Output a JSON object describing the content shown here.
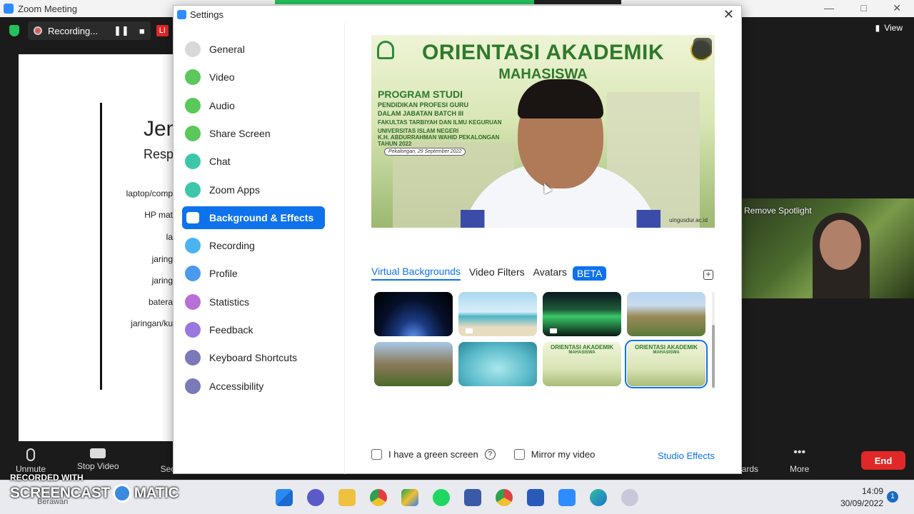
{
  "zoom_window": {
    "title": "Zoom Meeting",
    "recording_label": "Recording...",
    "live_badge": "LI",
    "view_label": "View",
    "spotlight_label": "Remove Spotlight"
  },
  "shared_slide": {
    "title": "Jen",
    "subtitle": "Resp",
    "lines": [
      "laptop/comp",
      "HP mat",
      "la",
      "jaring",
      "jaring",
      "batera",
      "jaringan/ku"
    ]
  },
  "toolbar": {
    "unmute": "Unmute",
    "stop_video": "Stop Video",
    "security": "Sec",
    "boards": "oards",
    "more": "More",
    "end": "End"
  },
  "settings": {
    "title": "Settings",
    "nav": [
      {
        "label": "General",
        "icon": "gear-icon",
        "color": "#d8d8d8"
      },
      {
        "label": "Video",
        "icon": "video-icon",
        "color": "#5ac85a"
      },
      {
        "label": "Audio",
        "icon": "headphones-icon",
        "color": "#5ac85a"
      },
      {
        "label": "Share Screen",
        "icon": "share-screen-icon",
        "color": "#5ac85a"
      },
      {
        "label": "Chat",
        "icon": "chat-icon",
        "color": "#3cc8a8"
      },
      {
        "label": "Zoom Apps",
        "icon": "apps-icon",
        "color": "#3cc8a8"
      },
      {
        "label": "Background & Effects",
        "icon": "background-icon",
        "color": "#ffffff"
      },
      {
        "label": "Recording",
        "icon": "record-icon",
        "color": "#4ab4f0"
      },
      {
        "label": "Profile",
        "icon": "profile-icon",
        "color": "#4a9af0"
      },
      {
        "label": "Statistics",
        "icon": "statistics-icon",
        "color": "#b870d8"
      },
      {
        "label": "Feedback",
        "icon": "feedback-icon",
        "color": "#9a78e0"
      },
      {
        "label": "Keyboard Shortcuts",
        "icon": "keyboard-icon",
        "color": "#7a7ab8"
      },
      {
        "label": "Accessibility",
        "icon": "accessibility-icon",
        "color": "#7a7ab8"
      }
    ],
    "active_index": 6,
    "preview": {
      "title_line1": "ORIENTASI AKADEMIK",
      "title_line2": "MAHASISWA",
      "program": "PROGRAM STUDI",
      "lines": [
        "PENDIDIKAN PROFESI GURU",
        "DALAM JABATAN BATCH III",
        "FAKULTAS TARBIYAH DAN ILMU KEGURUAN",
        "UNIVERSITAS ISLAM NEGERI",
        "K.H. ABDURRAHMAN WAHID PEKALONGAN",
        "TAHUN 2022"
      ],
      "date": "Pekalongan, 29 September 2022",
      "url": "uingusdur.ac.id"
    },
    "tabs": [
      "Virtual Backgrounds",
      "Video Filters",
      "Avatars"
    ],
    "beta": "BETA",
    "thumb_oa_title": "ORIENTASI AKADEMIK",
    "thumb_oa_sub": "MAHASISWA",
    "green_screen": "I have a green screen",
    "help": "?",
    "mirror": "Mirror my video",
    "studio_effects": "Studio Effects"
  },
  "taskbar": {
    "time": "14:09",
    "date": "30/09/2022",
    "notifications": "1",
    "weather": "Berawan"
  },
  "watermark": {
    "recorded_with": "RECORDED WITH",
    "brand_left": "SCREENCAST",
    "brand_right": "MATIC"
  }
}
